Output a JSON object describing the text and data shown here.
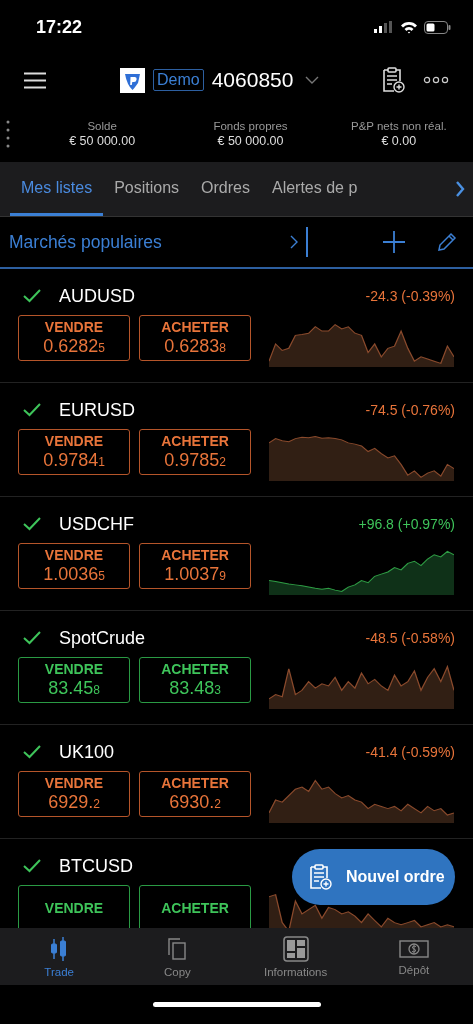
{
  "status_bar": {
    "time": "17:22"
  },
  "header": {
    "badge": "Demo",
    "account": "4060850"
  },
  "summary": [
    {
      "label": "Solde",
      "value": "€ 50 000.00"
    },
    {
      "label": "Fonds propres",
      "value": "€ 50 000.00"
    },
    {
      "label": "P&P nets non réal.",
      "value": "€ 0.00"
    }
  ],
  "tabs": [
    {
      "label": "Mes listes",
      "selected": true
    },
    {
      "label": "Positions",
      "selected": false
    },
    {
      "label": "Ordres",
      "selected": false
    },
    {
      "label": "Alertes de p",
      "selected": false
    }
  ],
  "list_header": {
    "title": "Marchés populaires"
  },
  "rows": [
    {
      "symbol": "AUDUSD",
      "change": "-24.3 (-0.39%)",
      "change_up": false,
      "quote_up": false,
      "sell": {
        "label": "VENDRE",
        "price": "0.6282",
        "pip": "5"
      },
      "buy": {
        "label": "ACHETER",
        "price": "0.6283",
        "pip": "8"
      }
    },
    {
      "symbol": "EURUSD",
      "change": "-74.5 (-0.76%)",
      "change_up": false,
      "quote_up": false,
      "sell": {
        "label": "VENDRE",
        "price": "0.9784",
        "pip": "1"
      },
      "buy": {
        "label": "ACHETER",
        "price": "0.9785",
        "pip": "2"
      }
    },
    {
      "symbol": "USDCHF",
      "change": "+96.8 (+0.97%)",
      "change_up": true,
      "quote_up": false,
      "sell": {
        "label": "VENDRE",
        "price": "1.0036",
        "pip": "5"
      },
      "buy": {
        "label": "ACHETER",
        "price": "1.0037",
        "pip": "9"
      }
    },
    {
      "symbol": "SpotCrude",
      "change": "-48.5 (-0.58%)",
      "change_up": false,
      "quote_up": true,
      "sell": {
        "label": "VENDRE",
        "price": "83.45",
        "pip": "8"
      },
      "buy": {
        "label": "ACHETER",
        "price": "83.48",
        "pip": "3"
      }
    },
    {
      "symbol": "UK100",
      "change": "-41.4 (-0.59%)",
      "change_up": false,
      "quote_up": false,
      "sell": {
        "label": "VENDRE",
        "price": "6929.",
        "pip": "2"
      },
      "buy": {
        "label": "ACHETER",
        "price": "6930.",
        "pip": "2"
      }
    },
    {
      "symbol": "BTCUSD",
      "change_up": false,
      "quote_up": true,
      "sell": {
        "label": "VENDRE"
      },
      "buy": {
        "label": "ACHETER"
      }
    }
  ],
  "fab": {
    "label": "Nouvel ordre"
  },
  "tab_bar": [
    {
      "label": "Trade",
      "kind": "candles",
      "selected": true
    },
    {
      "label": "Copy",
      "kind": "copy",
      "selected": false
    },
    {
      "label": "Informations",
      "kind": "dashboard",
      "selected": false
    },
    {
      "label": "Dépôt",
      "kind": "money",
      "selected": false
    }
  ]
}
